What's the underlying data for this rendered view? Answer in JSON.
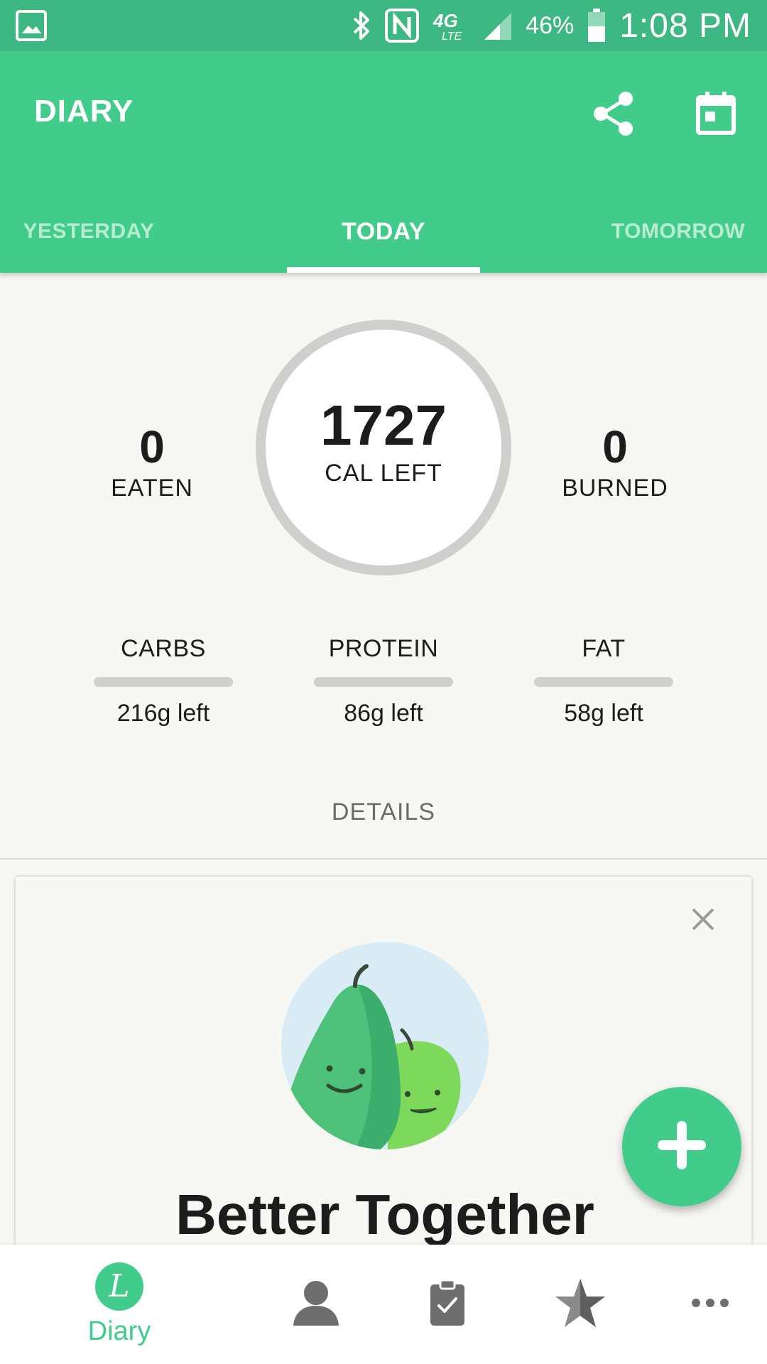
{
  "status_bar": {
    "time": "1:08 PM",
    "battery_percent": "46%",
    "network": "4G LTE",
    "icons": [
      "gallery-icon",
      "bluetooth-icon",
      "nfc-icon",
      "lte-icon",
      "signal-icon",
      "battery-icon"
    ]
  },
  "header": {
    "title": "DIARY",
    "share_icon": "share-icon",
    "calendar_icon": "calendar-icon"
  },
  "tabs": [
    {
      "label": "YESTERDAY",
      "active": false
    },
    {
      "label": "TODAY",
      "active": true
    },
    {
      "label": "TOMORROW",
      "active": false
    }
  ],
  "summary": {
    "eaten": {
      "value": "0",
      "label": "EATEN"
    },
    "cal_left": {
      "value": "1727",
      "label": "CAL LEFT"
    },
    "burned": {
      "value": "0",
      "label": "BURNED"
    },
    "calorie_progress": 0
  },
  "macros": [
    {
      "name": "CARBS",
      "left": "216g left",
      "progress": 0
    },
    {
      "name": "PROTEIN",
      "left": "86g left",
      "progress": 0
    },
    {
      "name": "FAT",
      "left": "58g left",
      "progress": 0
    }
  ],
  "details_label": "DETAILS",
  "promo": {
    "title": "Better Together",
    "close_icon": "close-icon",
    "illustration": "pear-and-apple-illustration"
  },
  "fab": {
    "icon": "plus-icon"
  },
  "bottom_nav": {
    "diary_label": "Diary",
    "diary_icon_letter": "L",
    "items": [
      "diary-icon",
      "profile-icon",
      "plans-clipboard-icon",
      "favorites-star-icon",
      "more-icon"
    ]
  },
  "colors": {
    "brand_green": "#42cc8c",
    "status_green": "#3db882",
    "background": "#f7f7f3",
    "ring_gray": "#cfcfcd",
    "text_dark": "#1c1c1c"
  }
}
